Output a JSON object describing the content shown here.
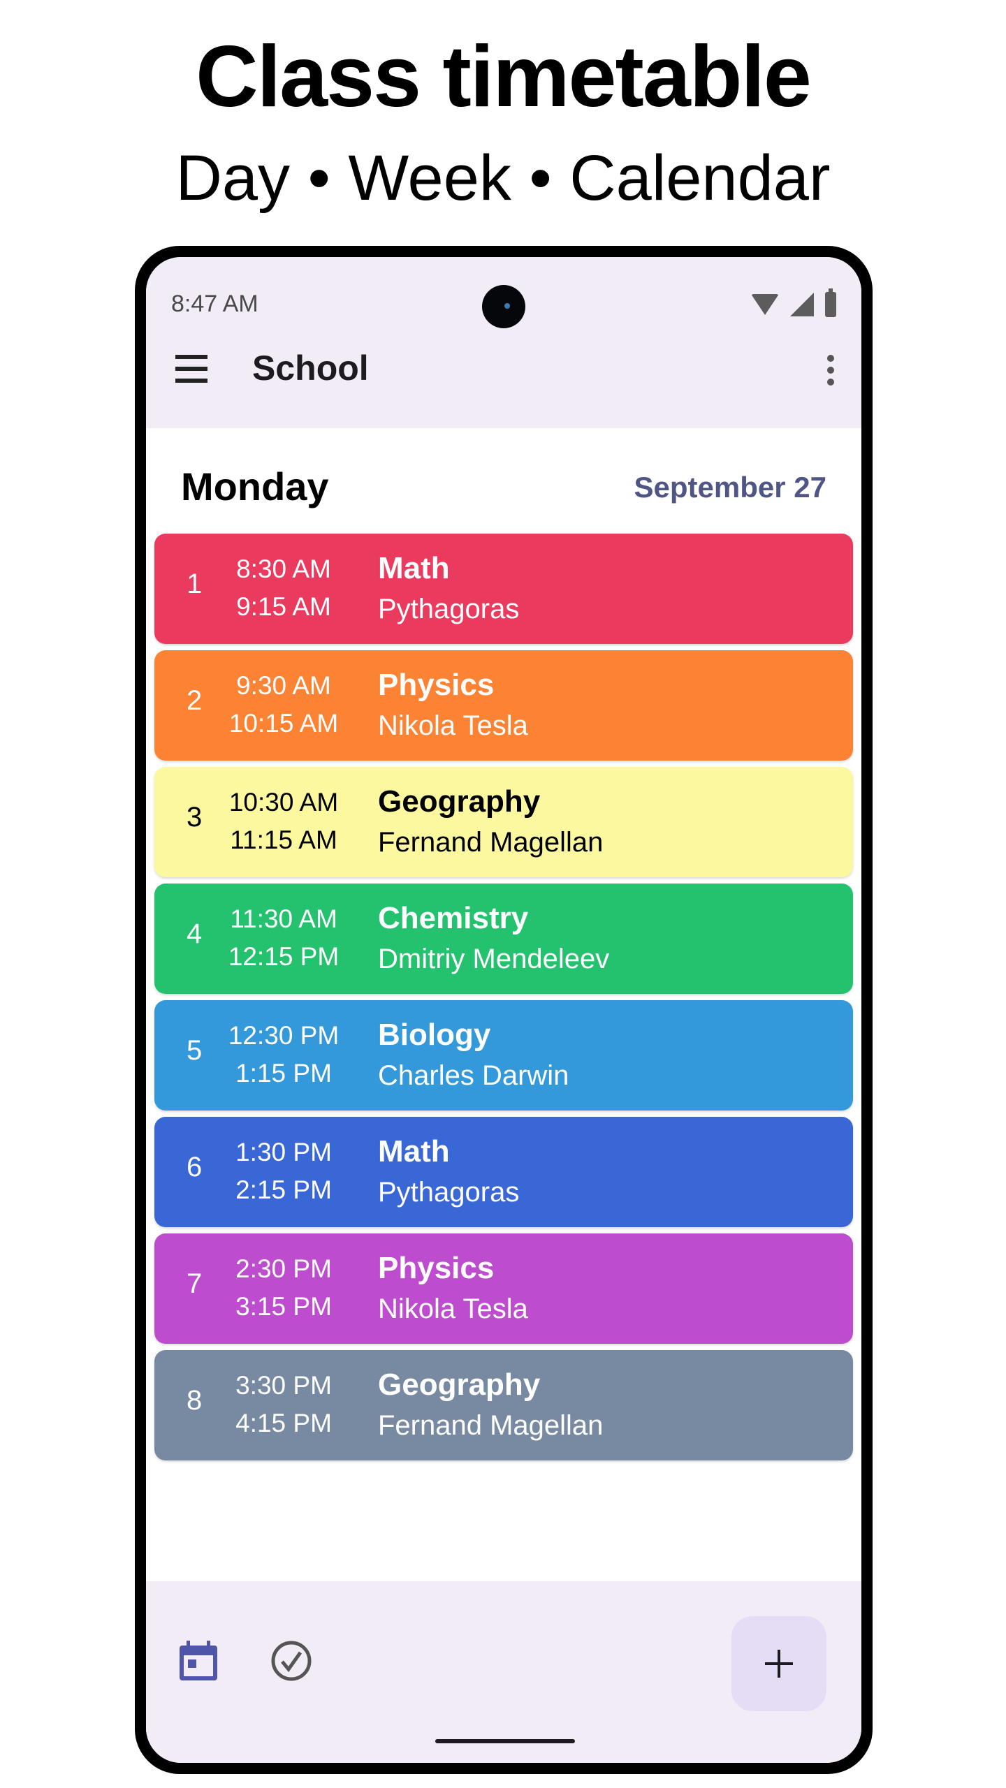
{
  "promo": {
    "title": "Class timetable",
    "subtitle": "Day • Week • Calendar"
  },
  "status_bar": {
    "time": "8:47 AM",
    "icons": [
      "wifi-icon",
      "signal-icon",
      "battery-icon"
    ]
  },
  "app_bar": {
    "menu_icon": "menu-icon",
    "title": "School",
    "more_icon": "more-vert-icon"
  },
  "day_header": {
    "day": "Monday",
    "date": "September 27",
    "date_color": "#4f5585"
  },
  "lessons": [
    {
      "number": "1",
      "start": "8:30 AM",
      "end": "9:15 AM",
      "subject": "Math",
      "teacher": "Pythagoras",
      "color": "#ea3a5e",
      "text": "light"
    },
    {
      "number": "2",
      "start": "9:30 AM",
      "end": "10:15 AM",
      "subject": "Physics",
      "teacher": "Nikola Tesla",
      "color": "#fb8333",
      "text": "light"
    },
    {
      "number": "3",
      "start": "10:30 AM",
      "end": "11:15 AM",
      "subject": "Geography",
      "teacher": "Fernand Magellan",
      "color": "#fcf89f",
      "text": "dark"
    },
    {
      "number": "4",
      "start": "11:30 AM",
      "end": "12:15 PM",
      "subject": "Chemistry",
      "teacher": "Dmitriy Mendeleev",
      "color": "#24c26e",
      "text": "light"
    },
    {
      "number": "5",
      "start": "12:30 PM",
      "end": "1:15 PM",
      "subject": "Biology",
      "teacher": "Charles Darwin",
      "color": "#3399db",
      "text": "light"
    },
    {
      "number": "6",
      "start": "1:30 PM",
      "end": "2:15 PM",
      "subject": "Math",
      "teacher": "Pythagoras",
      "color": "#3a67d6",
      "text": "light"
    },
    {
      "number": "7",
      "start": "2:30 PM",
      "end": "3:15 PM",
      "subject": "Physics",
      "teacher": "Nikola Tesla",
      "color": "#bd4ccf",
      "text": "light"
    },
    {
      "number": "8",
      "start": "3:30 PM",
      "end": "4:15 PM",
      "subject": "Geography",
      "teacher": "Fernand Magellan",
      "color": "#778aa1",
      "text": "light"
    }
  ],
  "bottom_bar": {
    "calendar_icon": "calendar-icon",
    "tasks_icon": "check-circle-icon",
    "fab_icon": "plus-icon",
    "active_color": "#4f55a8"
  }
}
